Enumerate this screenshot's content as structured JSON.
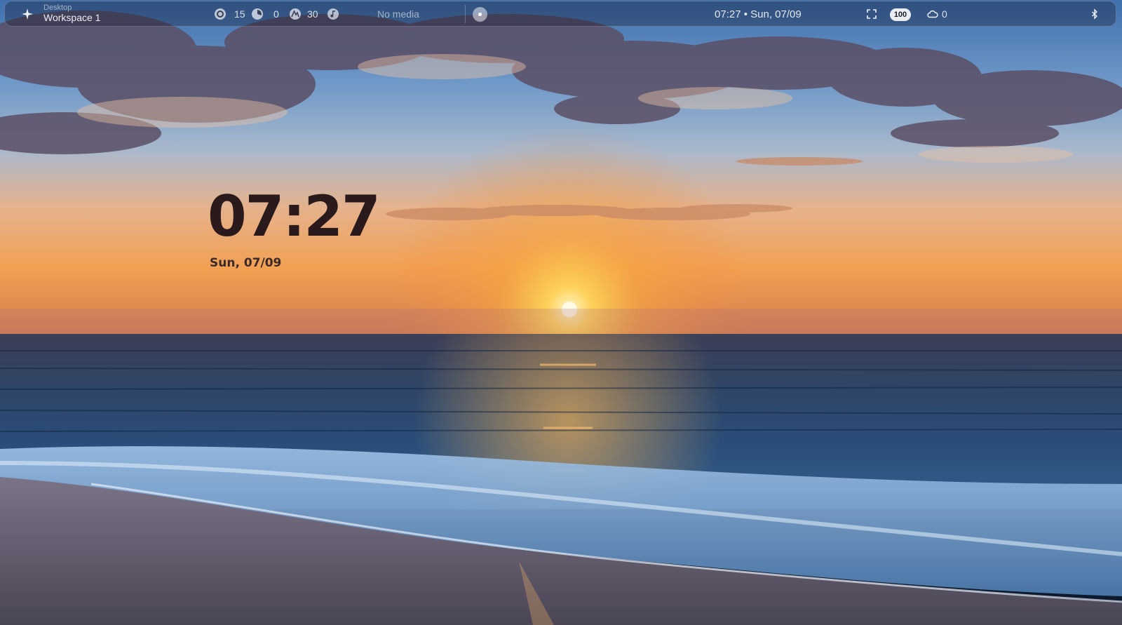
{
  "topbar": {
    "launcher_icon": "sparkle-icon",
    "workspace": {
      "subtitle": "Desktop",
      "title": "Workspace 1"
    },
    "resources": [
      {
        "icon": "cpu-gauge-icon",
        "value": "15"
      },
      {
        "icon": "memory-gauge-icon",
        "value": "0"
      },
      {
        "icon": "swap-gauge-icon",
        "value": "30"
      }
    ],
    "media": {
      "icon": "music-note-icon",
      "label": "No media",
      "control_icon": "media-dot-icon"
    },
    "clock": "07:27 • Sun, 07/09",
    "right": {
      "screenshot_icon": "fullscreen-icon",
      "battery": "100",
      "weather_icon": "cloud-icon",
      "weather_value": "0",
      "bluetooth_icon": "bluetooth-icon"
    }
  },
  "desktop": {
    "clock_time": "07:27",
    "clock_date": "Sun, 07/09"
  },
  "colors": {
    "clock_text": "#2a1a1c",
    "bar_text": "#ebeef5",
    "battery_pill": "#f5f5f8"
  }
}
